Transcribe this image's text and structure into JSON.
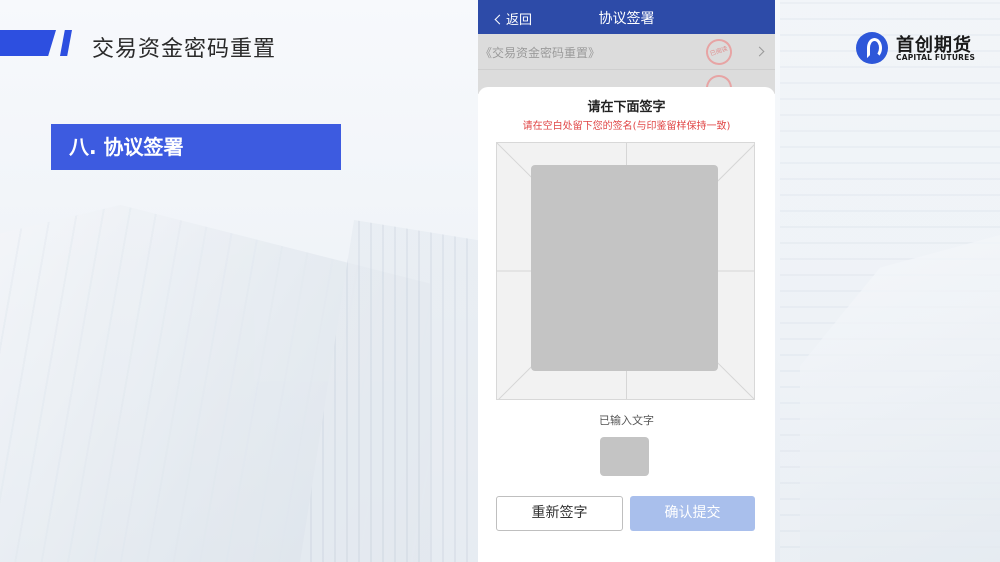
{
  "slide": {
    "title": "交易资金密码重置",
    "section_label": "八. 协议签署"
  },
  "logo": {
    "name_cn": "首创期货",
    "name_en": "CAPITAL FUTURES",
    "icon": "capital-futures-logo-icon"
  },
  "phone": {
    "navbar": {
      "back_label": "返回",
      "title": "协议签署"
    },
    "agreement_list": [
      {
        "label": "《交易资金密码重置》",
        "stamp": "已阅读"
      },
      {
        "label": "",
        "stamp": ""
      }
    ],
    "sign_sheet": {
      "title": "请在下面签字",
      "instruction": "请在空白处留下您的签名(与印鉴留样保持一致)",
      "typed_label": "已输入文字",
      "reset_button": "重新签字",
      "submit_button": "确认提交"
    }
  },
  "colors": {
    "accent": "#2d4fe0",
    "navbar": "#2d4ba8",
    "section_box": "#3d5be0",
    "warning_text": "#e04545",
    "submit_disabled": "#a9bfec"
  }
}
